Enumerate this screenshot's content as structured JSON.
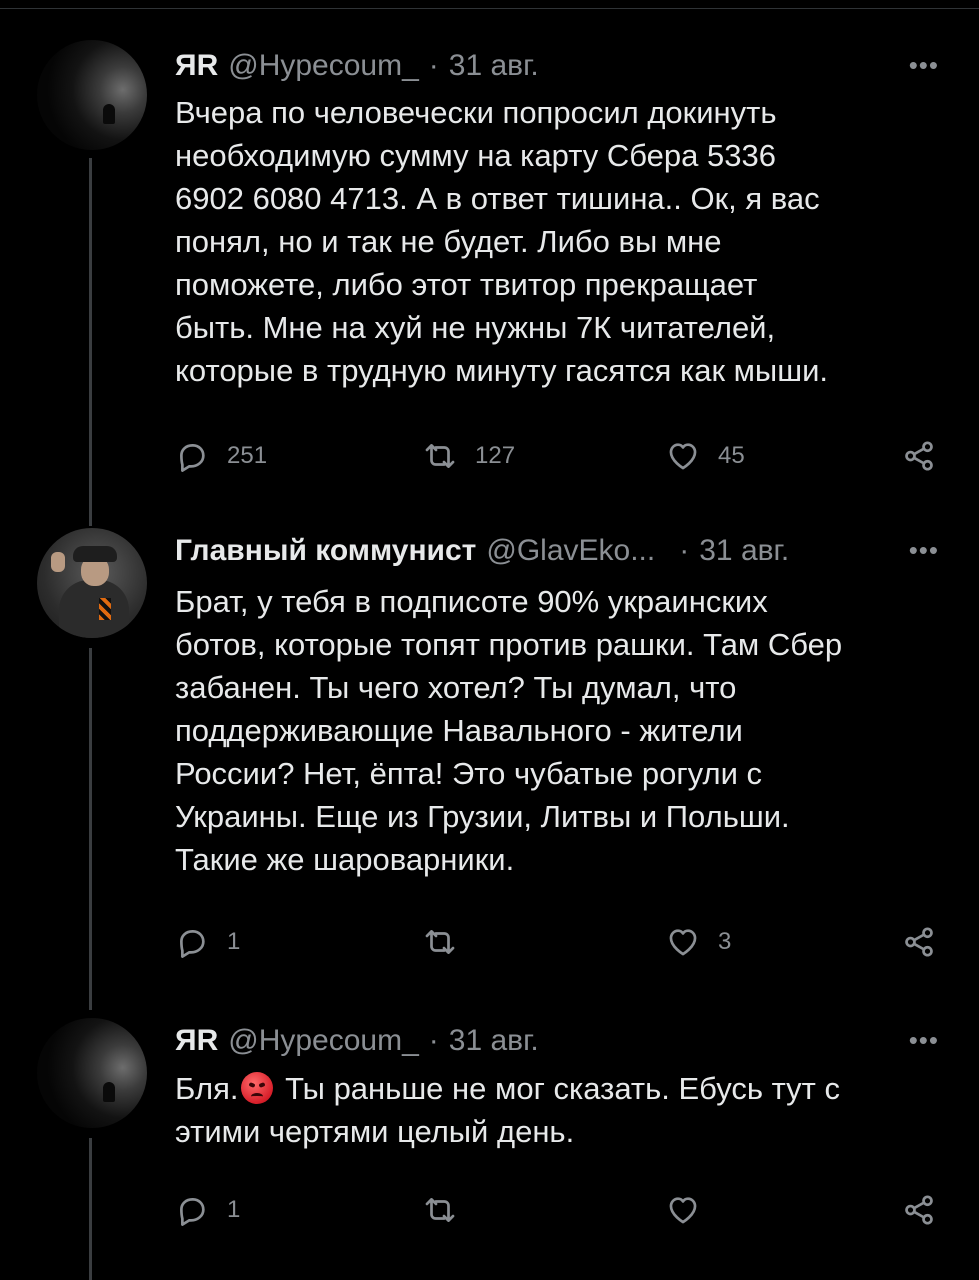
{
  "tweets": [
    {
      "name": "ЯR",
      "handle": "@Hypecoum_",
      "dot": "·",
      "date": "31 авг.",
      "more": "•••",
      "text": "Вчера по человечески попросил докинуть\nнеобходимую сумму на карту Сбера 5336\n6902 6080 4713. А в ответ тишина.. Ок, я вас\nпонял, но и так не будет. Либо вы мне\nпоможете, либо этот твитор прекращает\nбыть. Мне на хуй не нужны 7К читателей,\nкоторые в трудную минуту гасятся как мыши.",
      "replies": "251",
      "retweets": "127",
      "likes": "45"
    },
    {
      "name": "Главный коммунист",
      "handle": "@GlavEko...",
      "dot": "·",
      "date": "31 авг.",
      "more": "•••",
      "text": "Брат, у тебя в подписоте 90% украинских\nботов, которые топят против рашки. Там Сбер\nзабанен. Ты чего хотел? Ты думал, что\nподдерживающие Навального - жители\nРоссии? Нет, ёпта! Это чубатые рогули с\nУкраины. Еще из Грузии, Литвы и Польши.\nТакие же шароварники.",
      "replies": "1",
      "retweets": "",
      "likes": "3"
    },
    {
      "name": "ЯR",
      "handle": "@Hypecoum_",
      "dot": "·",
      "date": "31 авг.",
      "more": "•••",
      "text_before_emoji": "Бля.",
      "emoji": "pouting-face-emoji",
      "text_after_emoji": " Ты раньше не мог сказать. Ебусь тут с\nэтими чертями целый день.",
      "replies": "1",
      "retweets": "",
      "likes": ""
    }
  ],
  "icons": {
    "reply": "reply-icon",
    "retweet": "retweet-icon",
    "like": "heart-icon",
    "share": "share-icon"
  },
  "colors": {
    "background": "#000000",
    "text": "#e7e9ea",
    "secondary": "#8b8f94",
    "thread_line": "#3a3d40"
  }
}
